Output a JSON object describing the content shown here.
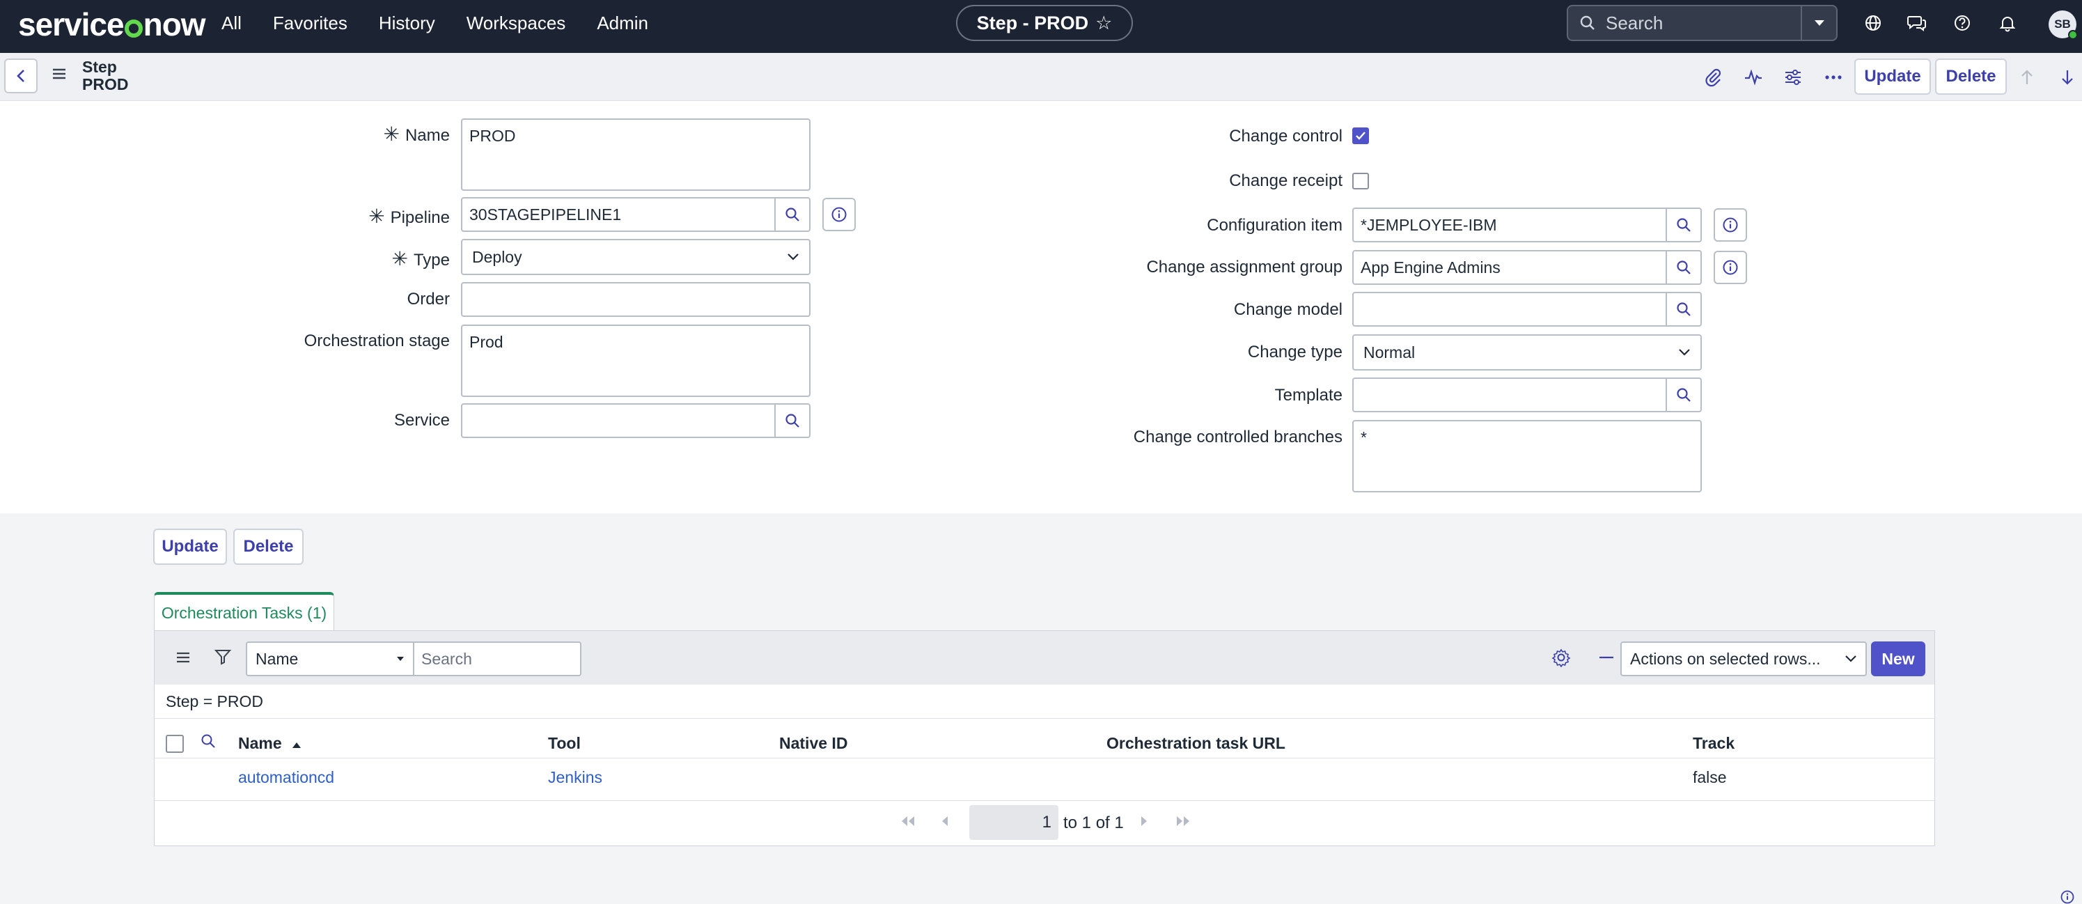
{
  "nav": {
    "logo": "servicenow",
    "links": [
      "All",
      "Favorites",
      "History",
      "Workspaces",
      "Admin"
    ],
    "record_pill": "Step - PROD",
    "search_placeholder": "Search",
    "user_initials": "SB"
  },
  "header": {
    "record_type": "Step",
    "record_name": "PROD",
    "update_label": "Update",
    "delete_label": "Delete"
  },
  "form": {
    "left": {
      "name_label": "Name",
      "name_value": "PROD",
      "pipeline_label": "Pipeline",
      "pipeline_value": "30STAGEPIPELINE1",
      "type_label": "Type",
      "type_value": "Deploy",
      "order_label": "Order",
      "order_value": "",
      "orch_stage_label": "Orchestration stage",
      "orch_stage_value": "Prod",
      "service_label": "Service",
      "service_value": ""
    },
    "right": {
      "change_control_label": "Change control",
      "change_control_checked": true,
      "change_receipt_label": "Change receipt",
      "change_receipt_checked": false,
      "config_item_label": "Configuration item",
      "config_item_value": "*JEMPLOYEE-IBM",
      "assign_group_label": "Change assignment group",
      "assign_group_value": "App Engine Admins",
      "change_model_label": "Change model",
      "change_model_value": "",
      "change_type_label": "Change type",
      "change_type_value": "Normal",
      "template_label": "Template",
      "template_value": "",
      "branches_label": "Change controlled branches",
      "branches_value": "*"
    },
    "update_label": "Update",
    "delete_label": "Delete"
  },
  "related": {
    "tab_label": "Orchestration Tasks (1)",
    "search_field": "Name",
    "search_placeholder": "Search",
    "actions_label": "Actions on selected rows...",
    "new_label": "New",
    "filter_text": "Step = PROD",
    "columns": [
      "Name",
      "Tool",
      "Native ID",
      "Orchestration task URL",
      "Track"
    ],
    "rows": [
      {
        "name": "automationcd",
        "tool": "Jenkins",
        "native_id": "",
        "url": "",
        "track": "false"
      }
    ],
    "page_current": "1",
    "page_summary": "to 1 of 1"
  },
  "colors": {
    "nav_bg": "#1c2332",
    "accent": "#4f52c9",
    "tab_accent": "#1f8a5c",
    "link": "#2d5fc7"
  }
}
